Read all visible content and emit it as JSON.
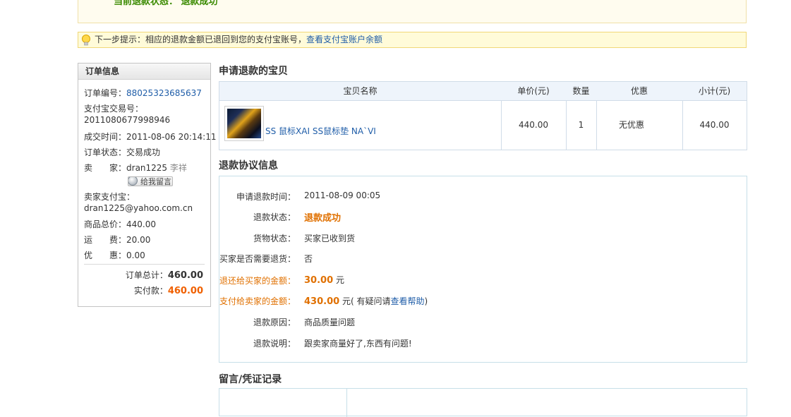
{
  "top_status": {
    "text": "当前退款状态：  退款成功"
  },
  "hint": {
    "text": "下一步提示：相应的退款金额已退回到您的支付宝账号，",
    "link": "查看支付宝账户余额"
  },
  "order_info": {
    "title": "订单信息",
    "order_no_label": "订单编号：",
    "order_no": "88025323685637",
    "alipay_trade_label": "支付宝交易号：",
    "alipay_trade_no": "2011080677998946",
    "deal_time_label": "成交时间：",
    "deal_time": "2011-08-06 20:14:11",
    "order_status_label": "订单状态：",
    "order_status": "交易成功",
    "seller_label": "卖　　家：",
    "seller_id": "dran1225",
    "seller_name": "李祥",
    "message_button": "给我留言",
    "seller_alipay_label": "卖家支付宝：",
    "seller_alipay": "dran1225@yahoo.com.cn",
    "goods_total_label": "商品总价：",
    "goods_total": "440.00",
    "shipping_label": "运　　费：",
    "shipping": "20.00",
    "discount_label": "优　　惠：",
    "discount": "0.00",
    "order_total_label": "订单总计：",
    "order_total": "460.00",
    "paid_label": "实付款：",
    "paid": "460.00"
  },
  "items_section": {
    "title": "申请退款的宝贝",
    "columns": [
      "宝贝名称",
      "单价(元)",
      "数量",
      "优惠",
      "小计(元)"
    ],
    "rows": [
      {
        "name": "SS 鼠标XAI SS鼠标垫 NA`VI",
        "price": "440.00",
        "qty": "1",
        "discount": "无优惠",
        "subtotal": "440.00"
      }
    ]
  },
  "agreement": {
    "title": "退款协议信息",
    "apply_time_label": "申请退款时间：",
    "apply_time": "2011-08-09 00:05",
    "refund_status_label": "退款状态：",
    "refund_status": "退款成功",
    "goods_status_label": "货物状态：",
    "goods_status": "买家已收到货",
    "need_return_label": "买家是否需要退货：",
    "need_return": "否",
    "refund_buyer_label": "退还给买家的金额：",
    "refund_buyer_amount": "30.00",
    "refund_buyer_unit": "元",
    "pay_seller_label": "支付给卖家的金额：",
    "pay_seller_amount": "430.00",
    "pay_seller_unit": "元",
    "help_prefix": "( 有疑问请",
    "help_link": "查看帮助",
    "help_suffix": ")",
    "reason_label": "退款原因：",
    "reason": "商品质量问题",
    "note_label": "退款说明：",
    "note": "跟卖家商量好了,东西有问题!"
  },
  "records": {
    "title": "留言/凭证记录"
  },
  "colors": {
    "link": "#1f5da8",
    "accent_orange": "#e07000",
    "success_green": "#3a8a00"
  }
}
